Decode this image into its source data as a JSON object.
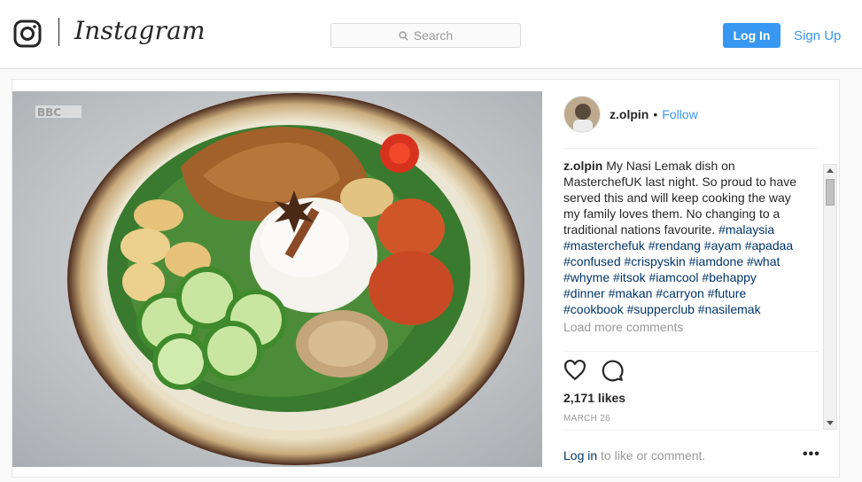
{
  "header": {
    "brand": "Instagram",
    "search_placeholder": "Search",
    "login_label": "Log In",
    "signup_label": "Sign Up"
  },
  "post": {
    "username": "z.olpin",
    "separator": "•",
    "follow_label": "Follow",
    "caption_author": "z.olpin",
    "caption_text": "My Nasi Lemak dish on MasterchefUK last night. So proud to have served this and will keep cooking the way my family loves them. No changing to a traditional nations favourite.",
    "hashtags": [
      "#malaysia",
      "#masterchefuk",
      "#rendang",
      "#ayam",
      "#apadaa",
      "#confused",
      "#crispyskin",
      "#iamdone",
      "#what",
      "#whyme",
      "#itsok",
      "#iamcool",
      "#behappy",
      "#dinner",
      "#makan",
      "#carryon",
      "#future",
      "#cookbook",
      "#supperclub",
      "#nasilemak"
    ],
    "load_more_label": "Load more comments",
    "likes": "2,171 likes",
    "date": "MARCH 26",
    "login_prompt_link": "Log in",
    "login_prompt_text": " to like or comment.",
    "more_options": "•••",
    "photo_watermark": "BBC"
  },
  "icons": {
    "logo": "instagram-camera-icon",
    "search": "search-icon",
    "like": "heart-icon",
    "comment": "comment-bubble-icon",
    "more": "more-options-icon"
  },
  "colors": {
    "accent": "#3897f0",
    "hashtag": "#003569",
    "muted": "#999999"
  }
}
